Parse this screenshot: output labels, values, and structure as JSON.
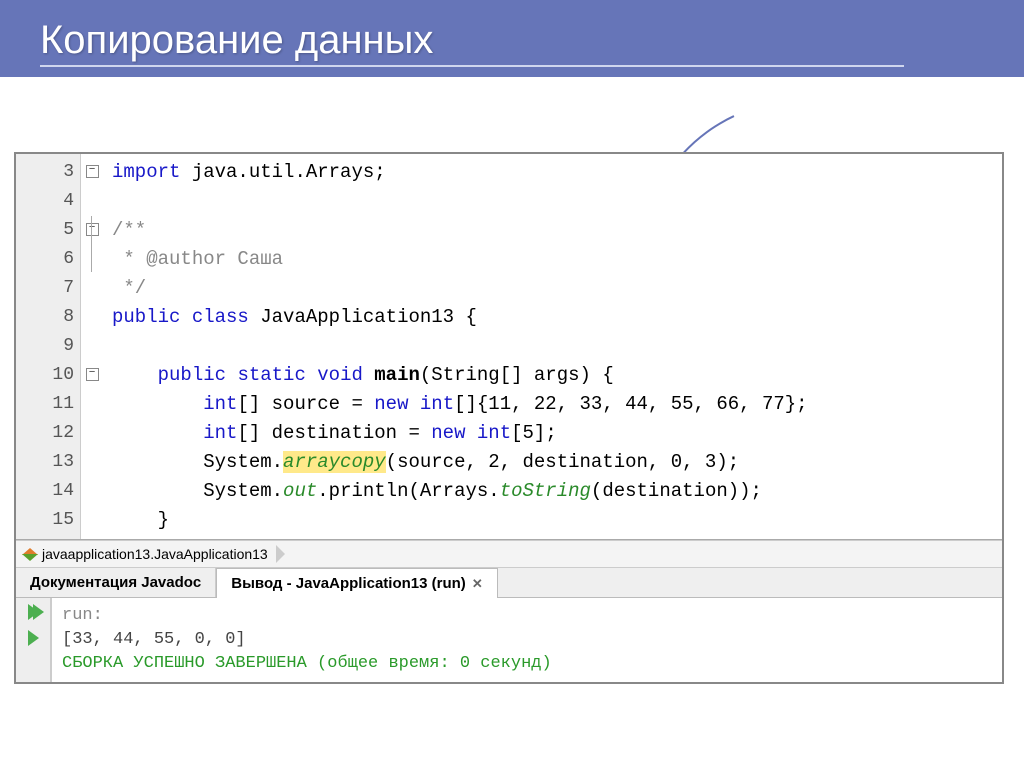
{
  "slide": {
    "title": "Копирование данных"
  },
  "gutter": [
    "3",
    "4",
    "5",
    "6",
    "7",
    "8",
    "9",
    "10",
    "11",
    "12",
    "13",
    "14",
    "15"
  ],
  "fold": {
    "l3": "−",
    "l5": "−",
    "l10": "−"
  },
  "code": {
    "l3": {
      "kw": "import",
      "rest": " java.util.Arrays;"
    },
    "l5": {
      "cm": "/**"
    },
    "l6": {
      "cm": " * @author Саша"
    },
    "l7": {
      "cm": " */"
    },
    "l8": {
      "kw1": "public",
      "kw2": "class",
      "cls": "JavaApplication13",
      "brace": " {"
    },
    "l10": {
      "kw1": "public",
      "kw2": "static",
      "kw3": "void",
      "m": "main",
      "args": "(String[] args) {"
    },
    "l11": {
      "kw": "int",
      "a": "[] source = ",
      "kw2": "new",
      "b": " int",
      "rest": "[]{11, 22, 33, 44, 55, 66, 77};"
    },
    "l12": {
      "kw": "int",
      "a": "[] destination = ",
      "kw2": "new",
      "b": " int",
      "rest": "[5];"
    },
    "l13": {
      "sys": "System.",
      "hl": "arraycopy",
      "rest": "(source, 2, destination, 0, 3);"
    },
    "l14": {
      "sys": "System.",
      "out": "out",
      "p": ".println(Arrays.",
      "ts": "toString",
      "rest": "(destination));"
    },
    "l15": {
      "brace": "}"
    }
  },
  "breadcrumb": {
    "text": "javaapplication13.JavaApplication13"
  },
  "tabs": {
    "doc": "Документация Javadoc",
    "output": "Вывод - JavaApplication13 (run)"
  },
  "output": {
    "run": "run:",
    "result": "[33, 44, 55, 0, 0]",
    "build": "СБОРКА УСПЕШНО ЗАВЕРШЕНА (общее время: 0 секунд)"
  }
}
